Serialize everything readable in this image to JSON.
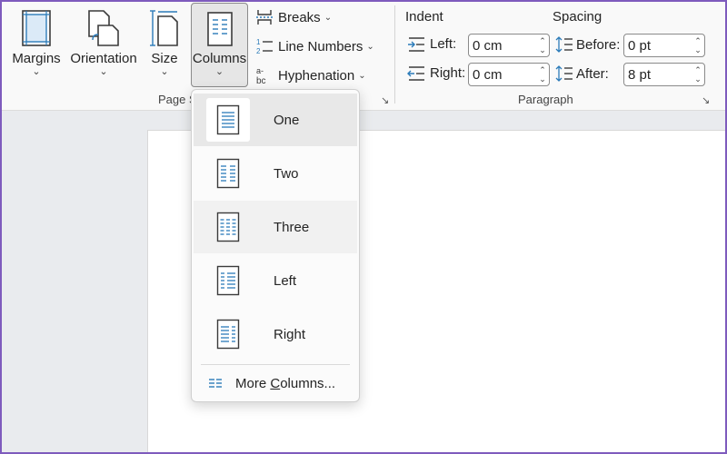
{
  "ribbon": {
    "page_setup": {
      "margins_label": "Margins",
      "orientation_label": "Orientation",
      "size_label": "Size",
      "columns_label": "Columns",
      "breaks_label": "Breaks",
      "line_numbers_label": "Line Numbers",
      "hyphenation_label": "Hyphenation",
      "group_label": "Page S"
    },
    "paragraph": {
      "indent_header": "Indent",
      "spacing_header": "Spacing",
      "left_label": "Left:",
      "right_label": "Right:",
      "before_label": "Before:",
      "after_label": "After:",
      "left_value": "0 cm",
      "right_value": "0 cm",
      "before_value": "0 pt",
      "after_value": "8 pt",
      "group_label": "Paragraph"
    }
  },
  "columns_menu": {
    "items": [
      {
        "label": "One"
      },
      {
        "label": "Two"
      },
      {
        "label": "Three"
      },
      {
        "label": "Left"
      },
      {
        "label": "Right"
      }
    ],
    "more_prefix": "More ",
    "more_underlined": "C",
    "more_suffix": "olumns..."
  },
  "colors": {
    "accent": "#2b7bb9",
    "frame": "#7e5bbd",
    "ribbon_bg": "#f9f9f9",
    "canvas_bg": "#e9ebee"
  },
  "icons": [
    "margins-icon",
    "orientation-icon",
    "size-icon",
    "columns-icon",
    "breaks-icon",
    "line-numbers-icon",
    "hyphenation-icon",
    "indent-left-icon",
    "indent-right-icon",
    "spacing-before-icon",
    "spacing-after-icon",
    "dialog-launcher-icon",
    "more-columns-icon"
  ]
}
